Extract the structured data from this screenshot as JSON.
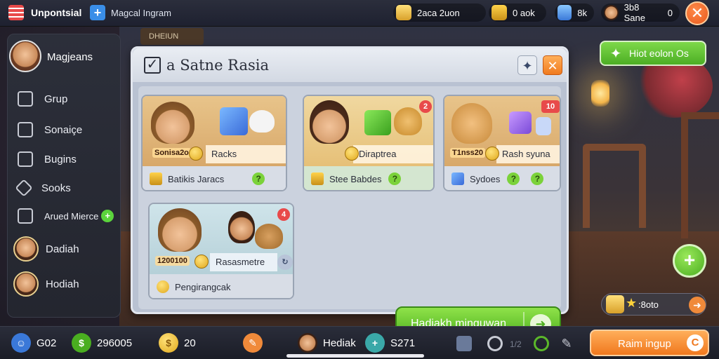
{
  "topbar": {
    "app_title": "Unpontsial",
    "subtitle": "Magcal Ingram",
    "res_gold": "2aca 2uon",
    "res_box": "0 aok",
    "res_gift": "8k",
    "res_player": "3b8 Sane",
    "res_player_count": "0"
  },
  "scene": {
    "sign": "DHEIUN"
  },
  "sidebar": {
    "user": "Magjeans",
    "items": [
      {
        "label": "Grup",
        "icon": "book-icon"
      },
      {
        "label": "Sonaiçe",
        "icon": "edit-icon"
      },
      {
        "label": "Bugins",
        "icon": "briefcase-icon"
      },
      {
        "label": "Sooks",
        "icon": "tag-icon"
      },
      {
        "label": "Arued Mierce",
        "icon": "share-icon"
      }
    ],
    "friends": [
      {
        "label": "Dadiah"
      },
      {
        "label": "Hodiah"
      }
    ]
  },
  "dialog": {
    "title": "a  Satne Rasia",
    "cards": [
      {
        "label": "Racks",
        "price": "Sonisa2o",
        "footer": "Batikis Jaracs"
      },
      {
        "label": "Diraptrea",
        "price": "",
        "footer": "Stee Babdes",
        "badge": "2"
      },
      {
        "label": "Rash syuna",
        "price": "T1nss20",
        "footer": "Sydoes",
        "badge": "10"
      },
      {
        "label": "Rasasmetre",
        "price": "1200100",
        "footer": "Pengirangcak",
        "badge": "4"
      }
    ],
    "cta_label": "Hadiakh minguwan"
  },
  "right": {
    "hint_label": "Hiot eolon  Os",
    "reward_label": ":8oto"
  },
  "bottombar": {
    "gold": "G02",
    "cash": "296005",
    "coins": "20",
    "hero": "Hediak",
    "gems": "S271",
    "level": "1/2",
    "cta": "Raim ingup"
  },
  "colors": {
    "accent_green": "#5bb82a",
    "accent_orange": "#f0781e",
    "panel": "#b9c2d2"
  }
}
